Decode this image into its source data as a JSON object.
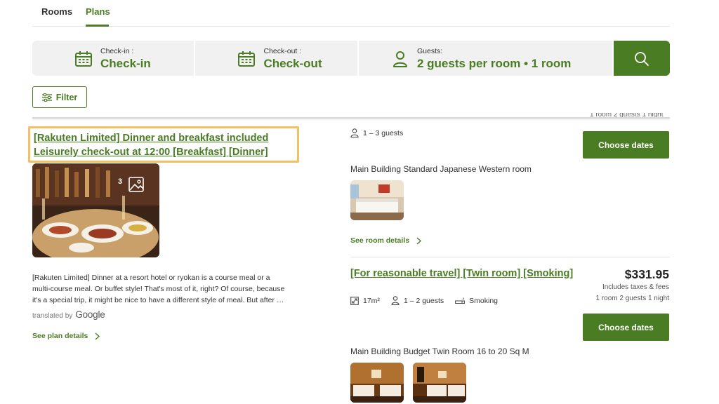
{
  "tabs": {
    "rooms": "Rooms",
    "plans": "Plans"
  },
  "search": {
    "checkin_label": "Check-in :",
    "checkin_value": "Check-in",
    "checkout_label": "Check-out :",
    "checkout_value": "Check-out",
    "guests_label": "Guests:",
    "guests_value": "2 guests per room  •  1 room"
  },
  "filter": {
    "label": "Filter"
  },
  "cut_off_text": "1 room  2 guests  1 night",
  "plan": {
    "title_line1": "[Rakuten Limited] Dinner and breakfast included",
    "title_line2": "Leisurely check-out at 12:00 [Breakfast] [Dinner]",
    "photo_count": "3",
    "description": "[Rakuten Limited] Dinner at a resort hotel or ryokan is a course meal or a multi-course meal. Or buffet style! That's most of it, right? Of course, because it's a special trip, it might be nice to have a different style of meal. But after …",
    "translated_by": "translated by",
    "google": "Google",
    "see_details": "See plan details"
  },
  "rooms": {
    "first": {
      "guests": "1 – 3 guests",
      "choose": "Choose dates",
      "name": "Main Building Standard Japanese Western room",
      "see_details": "See room details"
    },
    "second": {
      "title": "[For reasonable travel] [Twin room] [Smoking]",
      "price": "$331.95",
      "taxes": "Includes taxes & fees",
      "nights": "1 room  2 guests 1 night",
      "size": "17m²",
      "guests": "1 – 2 guests",
      "smoking": "Smoking",
      "choose": "Choose dates",
      "name": "Main Building Budget Twin Room 16 to 20 Sq M"
    }
  },
  "colors": {
    "brand_green": "#4a7c23",
    "highlight": "#f3c064",
    "search_bg": "#f1f1f1"
  }
}
